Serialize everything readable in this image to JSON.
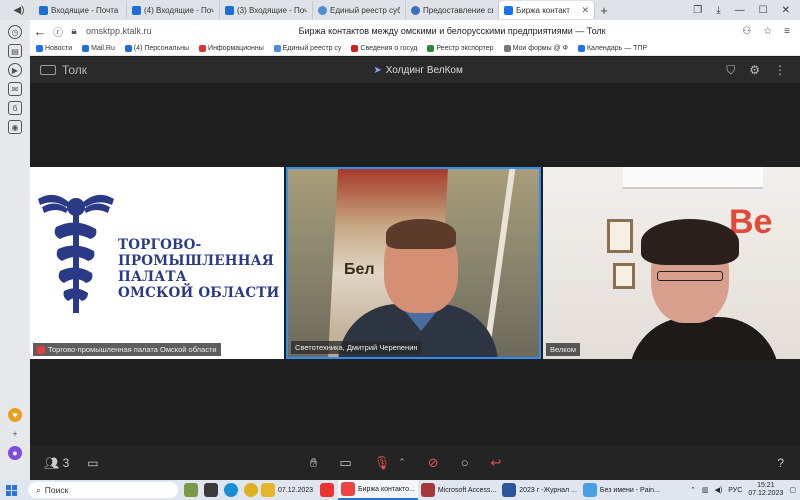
{
  "browser": {
    "tabs": [
      {
        "label": "Входящие - Почта M",
        "color": "#1d6fd6"
      },
      {
        "label": "(4) Входящие - Почт",
        "color": "#1d6fd6"
      },
      {
        "label": "(3) Входящие - Почт",
        "color": "#1d6fd6"
      },
      {
        "label": "Единый реестр субъ",
        "color": "#4c8dd6"
      },
      {
        "label": "Предоставление све",
        "color": "#3a6fc0"
      },
      {
        "label": "Биржа контакт",
        "color": "#1a73e8",
        "active": true
      }
    ],
    "new_tab": "+",
    "url": "omsktpp.ktalk.ru",
    "page_title": "Биржа контактов между омскими и белорусскими предприятиями — Толк",
    "bookmarks": [
      {
        "label": "Новости",
        "color": "#1a73e8"
      },
      {
        "label": "Mail.Ru",
        "color": "#1d6fd6"
      },
      {
        "label": "(4) Персональны",
        "color": "#1d6fd6"
      },
      {
        "label": "Информационны",
        "color": "#d33"
      },
      {
        "label": "Единый реестр су",
        "color": "#4c8dd6"
      },
      {
        "label": "Сведения о госуд",
        "color": "#c22"
      },
      {
        "label": "Реестр экспортер",
        "color": "#2a8a3a"
      },
      {
        "label": "Мои формы @ Ф",
        "color": "#777"
      },
      {
        "label": "Календарь — ТПР",
        "color": "#1a73e8"
      }
    ]
  },
  "talk": {
    "brand": "Толк",
    "room_title": "Холдинг ВелКом",
    "participants": [
      {
        "name": "Торгово-промышленная палата Омской области",
        "muted": true
      },
      {
        "name": "Светотехника, Дмитрий Черепенин",
        "muted": false
      },
      {
        "name": "Велком",
        "muted": false
      }
    ],
    "org_logo_text": [
      "ТОРГОВО-",
      "ПРОМЫШЛЕННАЯ",
      "ПАЛАТА",
      "ОМСКОЙ ОБЛАСТИ"
    ],
    "speaker_banner_text": "Бел",
    "wall_text": "Be",
    "participants_count": "3",
    "help": "?"
  },
  "taskbar": {
    "search_placeholder": "Поиск",
    "items": [
      {
        "label": "07.12.2023",
        "color": "#e6b52e"
      },
      {
        "label": "Биржа контакто...",
        "color": "#e44",
        "active": true
      },
      {
        "label": "Microsoft Access...",
        "color": "#a4373a"
      },
      {
        "label": "2023 г -Журнал ...",
        "color": "#2b579a"
      },
      {
        "label": "Без имени - Pain...",
        "color": "#4aa0e6"
      }
    ],
    "language": "РУС",
    "time": "15:21",
    "date": "07.12.2023"
  }
}
